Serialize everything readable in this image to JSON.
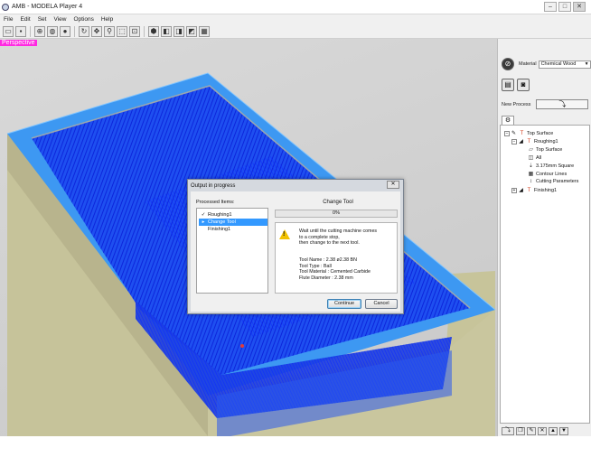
{
  "window": {
    "title": "AMB - MODELA Player 4",
    "minimize": "–",
    "maximize": "□",
    "close": "✕"
  },
  "menu": [
    "File",
    "Edit",
    "Set",
    "View",
    "Options",
    "Help"
  ],
  "toolbar_icons": [
    "open-icon",
    "save-icon",
    "center-icon",
    "rotate-view-icon",
    "solid-view-icon",
    "refresh-icon",
    "pan-icon",
    "zoom-icon",
    "fit-view-icon",
    "zoom-window-icon",
    "view-iso-icon",
    "view-top-icon",
    "view-front-icon",
    "view-side-icon",
    "grid-view-icon"
  ],
  "viewport": {
    "view_label": "Perspective"
  },
  "side_panel": {
    "material_label": "Material",
    "material_value": "Chemical Wood",
    "new_process_label": "New Process",
    "tree": [
      {
        "label": "Top Surface",
        "level": 0,
        "icon": "T"
      },
      {
        "label": "Roughing1",
        "level": 1,
        "icon": "T"
      },
      {
        "label": "Top Surface",
        "level": 2,
        "icon": "▱"
      },
      {
        "label": "All",
        "level": 2,
        "icon": "◫"
      },
      {
        "label": "3.175mm Square",
        "level": 2,
        "icon": "⇣"
      },
      {
        "label": "Contour Lines",
        "level": 2,
        "icon": "▦"
      },
      {
        "label": "Cutting Parameters",
        "level": 2,
        "icon": "↕"
      },
      {
        "label": "Finishing1",
        "level": 1,
        "icon": "T"
      }
    ]
  },
  "dialog": {
    "title": "Output in progress",
    "close": "✕",
    "processed_items_label": "Processed Items:",
    "items": [
      {
        "label": "Roughing1",
        "state": "done"
      },
      {
        "label": "Change Tool",
        "state": "current"
      },
      {
        "label": "Finishing1",
        "state": "pending"
      }
    ],
    "step_label": "Change Tool",
    "progress_percent": 0,
    "progress_text": "0%",
    "message": [
      "Wait until the cutting machine comes",
      "to a complete stop,",
      "then change to the next tool."
    ],
    "tool_details": [
      "Tool Name : 2.38 ø2.38 BN",
      "Tool Type : Ball",
      "Tool Material : Cemented Carbide",
      "Flute Diameter : 2.38 mm"
    ],
    "continue_label": "Continue",
    "cancel_label": "Cancel"
  }
}
